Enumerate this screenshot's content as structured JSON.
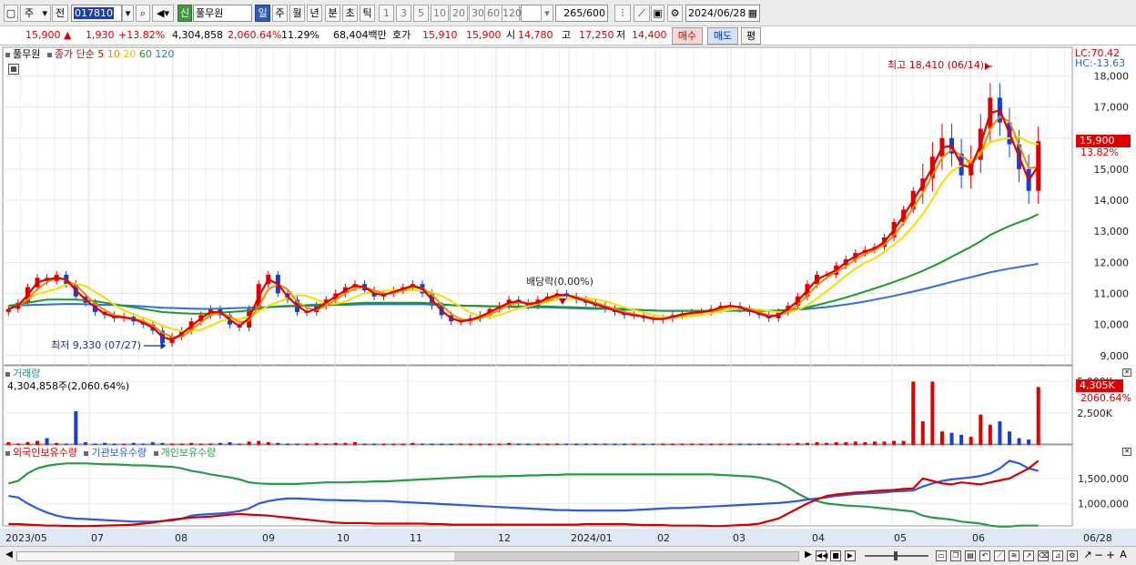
{
  "toolbar": {
    "period_sel": "주",
    "prev_label": "전",
    "code": "017810",
    "badge": "신",
    "stock_name": "풀무원",
    "periods": [
      "일",
      "주",
      "월",
      "년",
      "분",
      "초",
      "틱"
    ],
    "intervals": [
      "1",
      "3",
      "5",
      "10",
      "20",
      "30",
      "60",
      "120"
    ],
    "count": "265",
    "count_total": "/600",
    "date": "2024/06/28"
  },
  "quote": {
    "price": "15,900",
    "change": "1,930",
    "change_pct": "+13.82%",
    "volume": "4,304,858",
    "volume_pct": "2,060.64%",
    "turnover": "11.29%",
    "amount": "68,404백만",
    "bid_label": "호가",
    "bid1": "15,910",
    "bid2": "15,900",
    "open_label": "시",
    "open": "14,780",
    "high_label": "고",
    "high": "17,250",
    "low_label": "저",
    "low": "14,400",
    "buy": "매수",
    "sell": "매도",
    "eval": "평"
  },
  "price_panel": {
    "name": "풀무원",
    "ma_label": "종가 단순",
    "ma_periods": [
      "5",
      "10",
      "20",
      "60",
      "120"
    ],
    "lc": "LC:70.42",
    "hc": "HC:-13.63",
    "price_tag": "15,900",
    "pct_tag": "13.82%",
    "max_label": "최고 18,410 (06/14)",
    "min_label": "최저 9,330 (07/27)",
    "dividend_label": "배당락(0.00%)",
    "y_ticks": [
      "18,000",
      "17,000",
      "16,000",
      "15,000",
      "14,000",
      "13,000",
      "12,000",
      "11,000",
      "10,000",
      "9,000"
    ]
  },
  "volume_panel": {
    "title": "거래량",
    "value": "4,304,858주(2,060.64%)",
    "y_ticks": [
      "5,000K",
      "2,500K"
    ],
    "tag_value": "4,305K",
    "tag_pct": "2060.64%"
  },
  "holdings_panel": {
    "legend": [
      "외국인보유수량",
      "기관보유수량",
      "개인보유수량"
    ],
    "y_ticks": [
      "1,500,000",
      "1,000,000"
    ]
  },
  "x_axis": [
    "2023/05",
    "07",
    "08",
    "09",
    "10",
    "11",
    "12",
    "2024/01",
    "02",
    "03",
    "04",
    "05",
    "06",
    "06/28"
  ],
  "colors": {
    "up": "#e00000",
    "down": "#1a3fd0",
    "ma5": "#e00000",
    "ma10": "#f08a00",
    "ma20": "#f5e000",
    "ma60": "#1f9a2a",
    "ma120": "#2f6fe0",
    "foreign": "#d40000",
    "institution": "#2b5ce0",
    "individual": "#2a9a4a"
  },
  "chart_data": {
    "type": "candlestick",
    "price_range": [
      8700,
      18600
    ],
    "close": [
      10500,
      10700,
      11200,
      11500,
      11400,
      11600,
      11300,
      10900,
      10700,
      10400,
      10300,
      10200,
      10250,
      10100,
      10000,
      9800,
      9400,
      9600,
      9800,
      10100,
      10300,
      10500,
      10300,
      10000,
      9900,
      10500,
      11300,
      11600,
      11000,
      10800,
      10400,
      10400,
      10600,
      10800,
      11000,
      11200,
      11300,
      11100,
      10900,
      11000,
      11100,
      11200,
      11300,
      11000,
      10600,
      10300,
      10100,
      10100,
      10200,
      10300,
      10500,
      10600,
      10800,
      10700,
      10600,
      10800,
      10900,
      11000,
      10900,
      10800,
      10700,
      10600,
      10500,
      10400,
      10300,
      10300,
      10200,
      10150,
      10200,
      10300,
      10350,
      10400,
      10400,
      10500,
      10600,
      10600,
      10500,
      10400,
      10300,
      10200,
      10400,
      10600,
      10900,
      11300,
      11600,
      11600,
      11900,
      12100,
      12300,
      12400,
      12500,
      12800,
      13300,
      13700,
      14300,
      14700,
      15400,
      16000,
      15500,
      14800,
      15300,
      16300,
      17300,
      16500,
      15800,
      15000,
      14300,
      15900
    ],
    "ma60": [
      10600,
      10650,
      10700,
      10750,
      10800,
      10800,
      10800,
      10800,
      10780,
      10750,
      10700,
      10650,
      10600,
      10550,
      10500,
      10450,
      10400,
      10380,
      10360,
      10350,
      10350,
      10350,
      10380,
      10400,
      10420,
      10450,
      10500,
      10550,
      10580,
      10600,
      10600,
      10620,
      10640,
      10650,
      10650,
      10660,
      10680,
      10700,
      10700,
      10700,
      10700,
      10700,
      10700,
      10700,
      10680,
      10650,
      10620,
      10600,
      10600,
      10590,
      10580,
      10580,
      10580,
      10580,
      10580,
      10580,
      10580,
      10570,
      10560,
      10550,
      10540,
      10530,
      10520,
      10510,
      10500,
      10480,
      10460,
      10450,
      10440,
      10440,
      10440,
      10440,
      10440,
      10440,
      10450,
      10450,
      10450,
      10450,
      10440,
      10440,
      10450,
      10470,
      10500,
      10550,
      10620,
      10700,
      10780,
      10870,
      10960,
      11060,
      11160,
      11260,
      11370,
      11480,
      11600,
      11730,
      11870,
      12020,
      12180,
      12340,
      12500,
      12680,
      12880,
      13030,
      13170,
      13290,
      13400,
      13550
    ],
    "ma120": [
      10600,
      10610,
      10620,
      10630,
      10640,
      10650,
      10660,
      10660,
      10650,
      10640,
      10630,
      10620,
      10610,
      10600,
      10580,
      10560,
      10540,
      10530,
      10520,
      10510,
      10500,
      10500,
      10510,
      10520,
      10530,
      10540,
      10550,
      10560,
      10570,
      10580,
      10590,
      10600,
      10610,
      10620,
      10630,
      10630,
      10640,
      10650,
      10650,
      10650,
      10650,
      10650,
      10650,
      10650,
      10640,
      10630,
      10620,
      10610,
      10600,
      10600,
      10590,
      10580,
      10570,
      10560,
      10550,
      10550,
      10550,
      10540,
      10530,
      10520,
      10510,
      10500,
      10500,
      10490,
      10480,
      10470,
      10460,
      10450,
      10440,
      10440,
      10440,
      10440,
      10440,
      10440,
      10440,
      10440,
      10440,
      10440,
      10440,
      10440,
      10450,
      10460,
      10480,
      10500,
      10530,
      10560,
      10600,
      10640,
      10690,
      10740,
      10800,
      10860,
      10920,
      10990,
      11060,
      11130,
      11210,
      11290,
      11370,
      11450,
      11520,
      11600,
      11680,
      11740,
      11800,
      11850,
      11900,
      11950
    ],
    "volume_ratio": [
      0.04,
      0.02,
      0.04,
      0.06,
      0.1,
      0.03,
      0.02,
      0.5,
      0.04,
      0.02,
      0.03,
      0.02,
      0.02,
      0.03,
      0.02,
      0.04,
      0.03,
      0.02,
      0.02,
      0.03,
      0.02,
      0.02,
      0.03,
      0.04,
      0.02,
      0.05,
      0.06,
      0.04,
      0.03,
      0.02,
      0.02,
      0.02,
      0.03,
      0.02,
      0.03,
      0.03,
      0.04,
      0.02,
      0.02,
      0.02,
      0.02,
      0.02,
      0.03,
      0.02,
      0.02,
      0.02,
      0.02,
      0.02,
      0.02,
      0.02,
      0.02,
      0.02,
      0.03,
      0.02,
      0.02,
      0.02,
      0.02,
      0.02,
      0.02,
      0.02,
      0.02,
      0.02,
      0.02,
      0.02,
      0.02,
      0.02,
      0.02,
      0.02,
      0.02,
      0.02,
      0.02,
      0.02,
      0.02,
      0.02,
      0.02,
      0.02,
      0.02,
      0.02,
      0.02,
      0.02,
      0.02,
      0.02,
      0.03,
      0.03,
      0.04,
      0.03,
      0.04,
      0.04,
      0.05,
      0.04,
      0.05,
      0.05,
      0.06,
      0.06,
      0.94,
      0.35,
      0.94,
      0.2,
      0.18,
      0.15,
      0.12,
      0.45,
      0.3,
      0.35,
      0.2,
      0.1,
      0.08,
      0.86
    ],
    "foreign": [
      590000,
      590000,
      580000,
      570000,
      560000,
      560000,
      555000,
      550000,
      550000,
      555000,
      560000,
      565000,
      570000,
      580000,
      600000,
      620000,
      650000,
      680000,
      700000,
      720000,
      730000,
      740000,
      760000,
      780000,
      790000,
      780000,
      770000,
      760000,
      740000,
      720000,
      700000,
      680000,
      660000,
      640000,
      620000,
      610000,
      610000,
      610000,
      600000,
      600000,
      600000,
      600000,
      600000,
      600000,
      590000,
      590000,
      580000,
      580000,
      580000,
      580000,
      580000,
      580000,
      580000,
      580000,
      580000,
      580000,
      580000,
      580000,
      580000,
      580000,
      590000,
      590000,
      590000,
      590000,
      590000,
      580000,
      570000,
      570000,
      570000,
      560000,
      560000,
      560000,
      560000,
      550000,
      550000,
      560000,
      570000,
      580000,
      600000,
      650000,
      700000,
      800000,
      900000,
      1000000,
      1080000,
      1150000,
      1180000,
      1200000,
      1220000,
      1230000,
      1250000,
      1260000,
      1270000,
      1290000,
      1300000,
      1500000,
      1450000,
      1400000,
      1380000,
      1420000,
      1400000,
      1380000,
      1420000,
      1460000,
      1500000,
      1600000,
      1700000,
      1850000
    ],
    "institution": [
      1150000,
      1120000,
      1000000,
      900000,
      820000,
      760000,
      720000,
      700000,
      690000,
      680000,
      670000,
      660000,
      650000,
      640000,
      640000,
      640000,
      650000,
      660000,
      700000,
      760000,
      780000,
      790000,
      800000,
      820000,
      850000,
      900000,
      1000000,
      1050000,
      1080000,
      1100000,
      1100000,
      1090000,
      1080000,
      1070000,
      1070000,
      1060000,
      1060000,
      1050000,
      1050000,
      1050000,
      1040000,
      1030000,
      1020000,
      1010000,
      1000000,
      990000,
      980000,
      970000,
      960000,
      950000,
      940000,
      930000,
      920000,
      910000,
      900000,
      890000,
      880000,
      870000,
      870000,
      860000,
      860000,
      860000,
      860000,
      860000,
      860000,
      870000,
      880000,
      890000,
      900000,
      910000,
      910000,
      920000,
      930000,
      940000,
      950000,
      960000,
      970000,
      980000,
      990000,
      1000000,
      1010000,
      1030000,
      1050000,
      1080000,
      1100000,
      1120000,
      1150000,
      1170000,
      1190000,
      1200000,
      1210000,
      1220000,
      1240000,
      1250000,
      1260000,
      1340000,
      1400000,
      1450000,
      1480000,
      1500000,
      1520000,
      1550000,
      1600000,
      1700000,
      1850000,
      1800000,
      1700000,
      1650000
    ],
    "individual": [
      1400000,
      1450000,
      1600000,
      1700000,
      1750000,
      1780000,
      1800000,
      1800000,
      1800000,
      1790000,
      1780000,
      1780000,
      1770000,
      1760000,
      1760000,
      1750000,
      1740000,
      1730000,
      1700000,
      1650000,
      1620000,
      1580000,
      1550000,
      1520000,
      1480000,
      1420000,
      1400000,
      1390000,
      1390000,
      1390000,
      1390000,
      1400000,
      1410000,
      1420000,
      1420000,
      1420000,
      1430000,
      1430000,
      1440000,
      1440000,
      1450000,
      1460000,
      1470000,
      1480000,
      1490000,
      1500000,
      1510000,
      1520000,
      1530000,
      1540000,
      1540000,
      1540000,
      1550000,
      1550000,
      1560000,
      1560000,
      1570000,
      1570000,
      1580000,
      1580000,
      1580000,
      1580000,
      1580000,
      1580000,
      1580000,
      1580000,
      1580000,
      1580000,
      1580000,
      1580000,
      1580000,
      1580000,
      1580000,
      1580000,
      1570000,
      1560000,
      1550000,
      1540000,
      1520000,
      1480000,
      1420000,
      1320000,
      1200000,
      1100000,
      1050000,
      1000000,
      980000,
      960000,
      950000,
      940000,
      920000,
      900000,
      880000,
      860000,
      840000,
      760000,
      720000,
      700000,
      680000,
      640000,
      620000,
      600000,
      560000,
      540000,
      540000,
      560000,
      560000,
      560000
    ]
  }
}
